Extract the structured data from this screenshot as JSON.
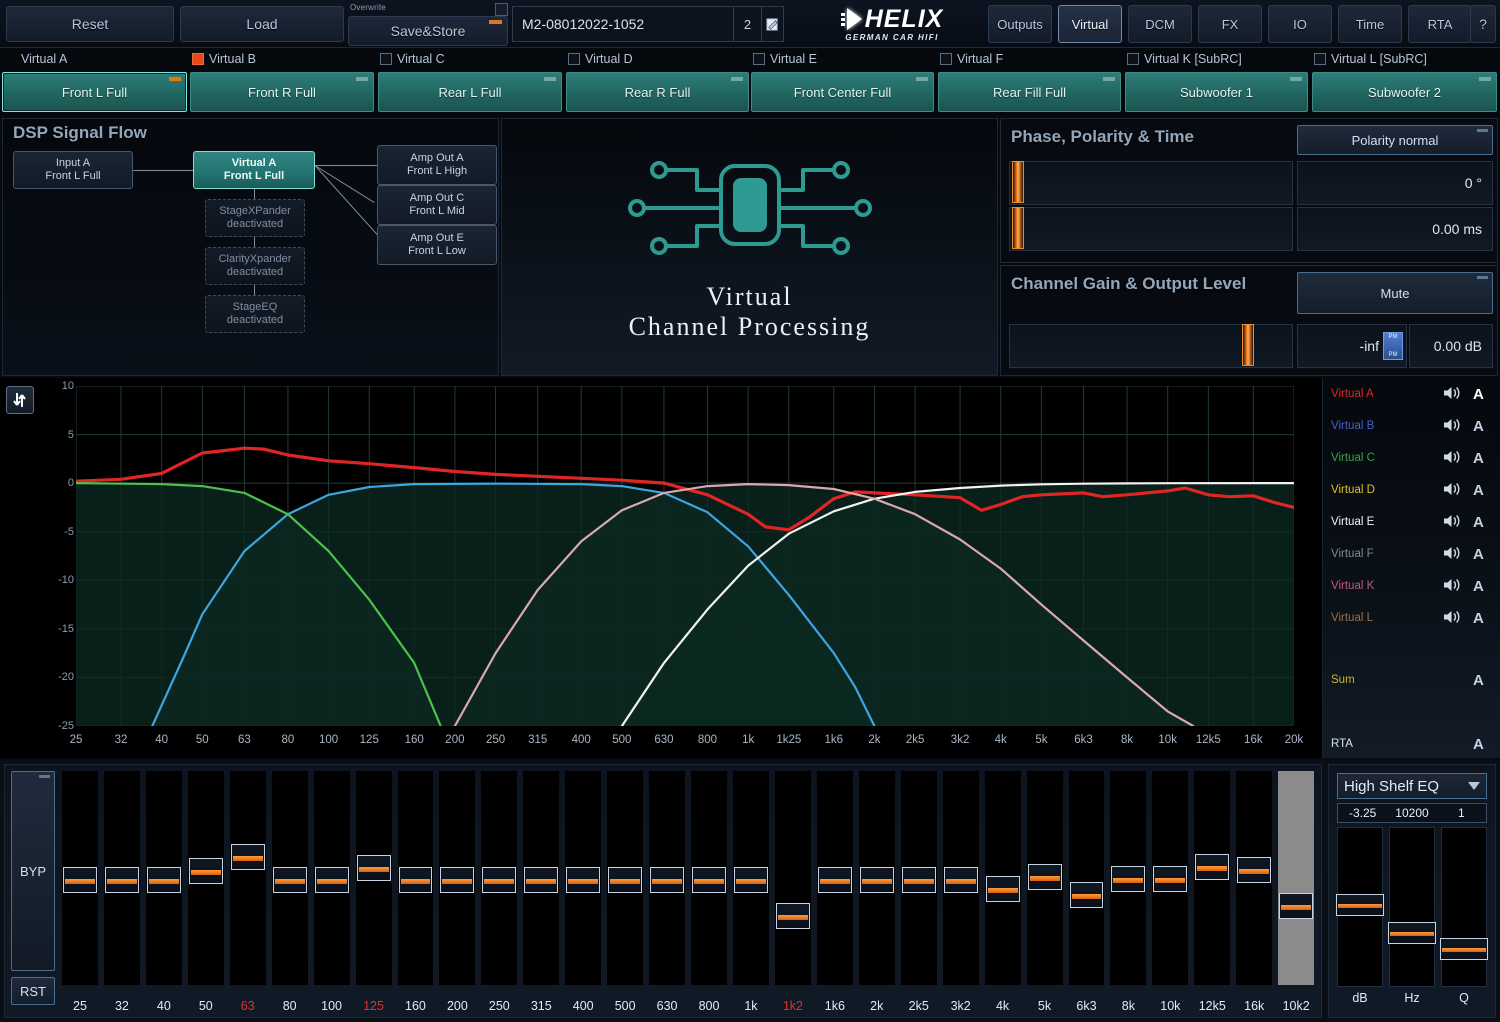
{
  "toolbar": {
    "reset": "Reset",
    "load": "Load",
    "overwrite_label": "Overwrite",
    "save_store": "Save&Store",
    "preset_name": "M2-08012022-1052",
    "preset_number": "2",
    "brand": "HELIX",
    "brand_sub": "GERMAN CAR HIFI",
    "nav": [
      {
        "label": "Outputs",
        "active": false
      },
      {
        "label": "Virtual",
        "active": true
      },
      {
        "label": "DCM",
        "active": false
      },
      {
        "label": "FX",
        "active": false
      },
      {
        "label": "IO",
        "active": false
      },
      {
        "label": "Time",
        "active": false
      },
      {
        "label": "RTA",
        "active": false
      }
    ],
    "help": "?"
  },
  "virtual_channels": [
    {
      "header": "Virtual A",
      "checked": false,
      "button": "Front L Full",
      "selected": true
    },
    {
      "header": "Virtual B",
      "checked": true,
      "button": "Front R Full",
      "selected": false
    },
    {
      "header": "Virtual C",
      "checked": false,
      "button": "Rear L Full",
      "selected": false
    },
    {
      "header": "Virtual D",
      "checked": false,
      "button": "Rear R Full",
      "selected": false
    },
    {
      "header": "Virtual E",
      "checked": false,
      "button": "Front Center Full",
      "selected": false
    },
    {
      "header": "Virtual F",
      "checked": false,
      "button": "Rear Fill Full",
      "selected": false
    },
    {
      "header": "Virtual K [SubRC]",
      "checked": false,
      "button": "Subwoofer 1",
      "selected": false
    },
    {
      "header": "Virtual L [SubRC]",
      "checked": false,
      "button": "Subwoofer 2",
      "selected": false
    }
  ],
  "signal_flow": {
    "title": "DSP Signal Flow",
    "input": {
      "line1": "Input A",
      "line2": "Front L Full"
    },
    "virtual": {
      "line1": "Virtual A",
      "line2": "Front L Full"
    },
    "processors": [
      {
        "line1": "StageXPander",
        "line2": "deactivated"
      },
      {
        "line1": "ClarityXpander",
        "line2": "deactivated"
      },
      {
        "line1": "StageEQ",
        "line2": "deactivated"
      }
    ],
    "amp_outs": [
      {
        "line1": "Amp Out A",
        "line2": "Front L High"
      },
      {
        "line1": "Amp Out C",
        "line2": "Front L Mid"
      },
      {
        "line1": "Amp Out E",
        "line2": "Front L Low"
      }
    ]
  },
  "vcp": {
    "line1": "Virtual",
    "line2": "Channel Processing",
    "icon": "chip-icon"
  },
  "phase_panel": {
    "title": "Phase, Polarity & Time",
    "polarity_button": "Polarity normal",
    "phase_value": "0 °",
    "time_value": "0.00 ms"
  },
  "gain_panel": {
    "title": "Channel Gain & Output Level",
    "mute_button": "Mute",
    "level_value": "-inf dB",
    "level_badge_top": "PM",
    "level_badge_bottom": "PM",
    "gain_value": "0.00 dB"
  },
  "chart_data": {
    "type": "line",
    "title": "",
    "xlabel": "",
    "ylabel": "dB",
    "grid": true,
    "x_ticks": [
      "25",
      "32",
      "40",
      "50",
      "63",
      "80",
      "100",
      "125",
      "160",
      "200",
      "250",
      "315",
      "400",
      "500",
      "630",
      "800",
      "1k",
      "1k25",
      "1k6",
      "2k",
      "2k5",
      "3k2",
      "4k",
      "5k",
      "6k3",
      "8k",
      "10k",
      "12k5",
      "16k",
      "20k"
    ],
    "y_ticks": [
      10,
      5,
      0,
      -5,
      -10,
      -15,
      -20,
      -25
    ],
    "ylim": [
      -25,
      10
    ],
    "xlim_hz": [
      25,
      20000
    ],
    "series": [
      {
        "name": "Virtual A",
        "color": "#e02525",
        "points": [
          [
            25,
            0.2
          ],
          [
            32,
            0.4
          ],
          [
            40,
            1.0
          ],
          [
            50,
            3.1
          ],
          [
            55,
            3.3
          ],
          [
            63,
            3.6
          ],
          [
            70,
            3.5
          ],
          [
            80,
            2.9
          ],
          [
            100,
            2.3
          ],
          [
            125,
            2.0
          ],
          [
            160,
            1.6
          ],
          [
            200,
            1.2
          ],
          [
            250,
            0.9
          ],
          [
            315,
            0.7
          ],
          [
            400,
            0.5
          ],
          [
            500,
            0.3
          ],
          [
            630,
            0.0
          ],
          [
            800,
            -1.2
          ],
          [
            1000,
            -3.2
          ],
          [
            1100,
            -4.5
          ],
          [
            1250,
            -4.8
          ],
          [
            1400,
            -3.5
          ],
          [
            1600,
            -1.6
          ],
          [
            1800,
            -0.9
          ],
          [
            2000,
            -1.0
          ],
          [
            2500,
            -1.2
          ],
          [
            3200,
            -1.5
          ],
          [
            3600,
            -2.8
          ],
          [
            4000,
            -2.2
          ],
          [
            4500,
            -1.4
          ],
          [
            5000,
            -1.2
          ],
          [
            6300,
            -1.0
          ],
          [
            7000,
            -1.4
          ],
          [
            8000,
            -1.2
          ],
          [
            10000,
            -0.8
          ],
          [
            11000,
            -0.5
          ],
          [
            12500,
            -1.2
          ],
          [
            14000,
            -1.4
          ],
          [
            16000,
            -1.3
          ],
          [
            18000,
            -2.0
          ],
          [
            20000,
            -2.5
          ]
        ]
      },
      {
        "name": "Virtual B",
        "color": "#3da5e0",
        "points": [
          [
            38,
            -25
          ],
          [
            45,
            -18
          ],
          [
            50,
            -13.5
          ],
          [
            63,
            -7.0
          ],
          [
            80,
            -3.2
          ],
          [
            100,
            -1.2
          ],
          [
            125,
            -0.4
          ],
          [
            160,
            -0.1
          ],
          [
            250,
            -0.05
          ],
          [
            400,
            -0.1
          ],
          [
            500,
            -0.3
          ],
          [
            630,
            -1.0
          ],
          [
            800,
            -3.0
          ],
          [
            1000,
            -6.5
          ],
          [
            1250,
            -11.5
          ],
          [
            1600,
            -17.5
          ],
          [
            1800,
            -21
          ],
          [
            2000,
            -25
          ]
        ]
      },
      {
        "name": "Virtual C",
        "color": "#4cc14c",
        "points": [
          [
            25,
            0.0
          ],
          [
            40,
            -0.1
          ],
          [
            50,
            -0.3
          ],
          [
            63,
            -1.0
          ],
          [
            80,
            -3.2
          ],
          [
            100,
            -7.0
          ],
          [
            125,
            -12.0
          ],
          [
            160,
            -18.5
          ],
          [
            185,
            -25
          ]
        ]
      },
      {
        "name": "Virtual E",
        "color": "#f2f2f2",
        "points": [
          [
            500,
            -25
          ],
          [
            630,
            -18.5
          ],
          [
            800,
            -13.0
          ],
          [
            1000,
            -8.5
          ],
          [
            1250,
            -5.2
          ],
          [
            1600,
            -2.9
          ],
          [
            2000,
            -1.6
          ],
          [
            2500,
            -0.9
          ],
          [
            3200,
            -0.5
          ],
          [
            4000,
            -0.25
          ],
          [
            5000,
            -0.12
          ],
          [
            6300,
            -0.06
          ],
          [
            8000,
            -0.03
          ],
          [
            10000,
            -0.01
          ],
          [
            20000,
            0.0
          ]
        ]
      },
      {
        "name": "Virtual K",
        "color": "#dba8b0",
        "points": [
          [
            200,
            -25
          ],
          [
            250,
            -17.5
          ],
          [
            315,
            -11.0
          ],
          [
            400,
            -6.0
          ],
          [
            500,
            -2.8
          ],
          [
            630,
            -1.0
          ],
          [
            800,
            -0.3
          ],
          [
            1000,
            -0.1
          ],
          [
            1250,
            -0.2
          ],
          [
            1600,
            -0.6
          ],
          [
            2000,
            -1.6
          ],
          [
            2500,
            -3.2
          ],
          [
            3200,
            -5.8
          ],
          [
            4000,
            -8.8
          ],
          [
            5000,
            -12.5
          ],
          [
            6300,
            -16.2
          ],
          [
            8000,
            -20.0
          ],
          [
            10000,
            -23.5
          ],
          [
            11500,
            -25
          ]
        ]
      }
    ],
    "legend": [
      {
        "label": "Virtual A",
        "color": "#e02525",
        "letter": "A"
      },
      {
        "label": "Virtual B",
        "color": "#4a5fd0",
        "letter": "A"
      },
      {
        "label": "Virtual C",
        "color": "#3f9f3f",
        "letter": "A"
      },
      {
        "label": "Virtual D",
        "color": "#d9c02a",
        "letter": "A"
      },
      {
        "label": "Virtual E",
        "color": "#f2f2f2",
        "letter": "A"
      },
      {
        "label": "Virtual F",
        "color": "#7c8a99",
        "letter": "A"
      },
      {
        "label": "Virtual K",
        "color": "#c05a7a",
        "letter": "A"
      },
      {
        "label": "Virtual L",
        "color": "#9a7048",
        "letter": "A"
      },
      {
        "label": "Sum",
        "color": "#c9b42c",
        "letter": "A"
      },
      {
        "label": "RTA",
        "color": "#d6e1ee",
        "letter": "A"
      }
    ]
  },
  "eq": {
    "bypass": "BYP",
    "reset": "RST",
    "bands": [
      {
        "label": "25",
        "red": false,
        "highlight": false,
        "gain": 0.0
      },
      {
        "label": "32",
        "red": false,
        "highlight": false,
        "gain": 0.0
      },
      {
        "label": "40",
        "red": false,
        "highlight": false,
        "gain": 0.0
      },
      {
        "label": "50",
        "red": false,
        "highlight": false,
        "gain": 1.2
      },
      {
        "label": "63",
        "red": true,
        "highlight": false,
        "gain": 3.0
      },
      {
        "label": "80",
        "red": false,
        "highlight": false,
        "gain": 0.0
      },
      {
        "label": "100",
        "red": false,
        "highlight": false,
        "gain": 0.0
      },
      {
        "label": "125",
        "red": true,
        "highlight": false,
        "gain": 1.6
      },
      {
        "label": "160",
        "red": false,
        "highlight": false,
        "gain": 0.0
      },
      {
        "label": "200",
        "red": false,
        "highlight": false,
        "gain": 0.0
      },
      {
        "label": "250",
        "red": false,
        "highlight": false,
        "gain": 0.0
      },
      {
        "label": "315",
        "red": false,
        "highlight": false,
        "gain": 0.0
      },
      {
        "label": "400",
        "red": false,
        "highlight": false,
        "gain": 0.0
      },
      {
        "label": "500",
        "red": false,
        "highlight": false,
        "gain": 0.0
      },
      {
        "label": "630",
        "red": false,
        "highlight": false,
        "gain": 0.0
      },
      {
        "label": "800",
        "red": false,
        "highlight": false,
        "gain": 0.0
      },
      {
        "label": "1k",
        "red": false,
        "highlight": false,
        "gain": 0.0
      },
      {
        "label": "1k2",
        "red": true,
        "highlight": false,
        "gain": -4.6
      },
      {
        "label": "1k6",
        "red": false,
        "highlight": false,
        "gain": 0.0
      },
      {
        "label": "2k",
        "red": false,
        "highlight": false,
        "gain": 0.0
      },
      {
        "label": "2k5",
        "red": false,
        "highlight": false,
        "gain": 0.0
      },
      {
        "label": "3k2",
        "red": false,
        "highlight": false,
        "gain": 0.0
      },
      {
        "label": "4k",
        "red": false,
        "highlight": false,
        "gain": -1.1
      },
      {
        "label": "5k",
        "red": false,
        "highlight": false,
        "gain": 0.4
      },
      {
        "label": "6k3",
        "red": false,
        "highlight": false,
        "gain": -1.9
      },
      {
        "label": "8k",
        "red": false,
        "highlight": false,
        "gain": 0.1
      },
      {
        "label": "10k",
        "red": false,
        "highlight": false,
        "gain": 0.1
      },
      {
        "label": "12k5",
        "red": false,
        "highlight": false,
        "gain": 1.7
      },
      {
        "label": "16k",
        "red": false,
        "highlight": false,
        "gain": 1.3
      },
      {
        "label": "10k2",
        "red": false,
        "highlight": true,
        "gain": -3.25
      }
    ]
  },
  "shelf": {
    "type_label": "High Shelf EQ",
    "db_value": "-3.25",
    "hz_value": "10200",
    "q_value": "1",
    "axis": [
      "dB",
      "Hz",
      "Q"
    ],
    "db_pos": 0.48,
    "hz_pos": 0.68,
    "q_pos": 0.8
  }
}
